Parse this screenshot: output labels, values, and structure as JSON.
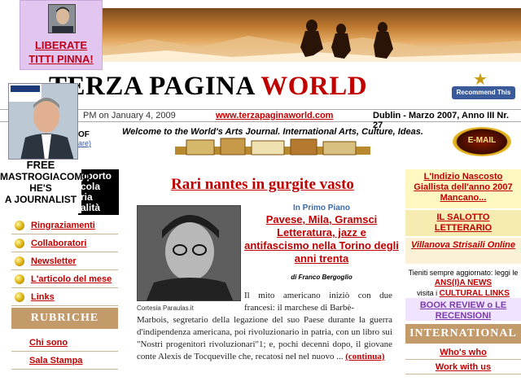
{
  "banner": {
    "description_icon": "hikers-sunset-photo"
  },
  "campaign": {
    "line1": "LIBERATE",
    "line2": "TITTI PINNA!",
    "photo_icon": "portrait-photo"
  },
  "header": {
    "title_black": "TERZA PAGINA",
    "title_red": "WORLD",
    "recommend_label": "Recommend This Site",
    "recommend_icon": "star-icon"
  },
  "info": {
    "date": "PM on January 4, 2009",
    "url": "www.terzapaginaworld.com",
    "edition": "Dublin - Marzo 2007, Anno III Nr. 27"
  },
  "welcome": "Welcome to the World's Arts Journal. International Arts, Culture, Ideas.",
  "email_label": "E-MAIL",
  "overlay": {
    "free_line1": "FREE",
    "free_line2": "MASTROGIACOMO",
    "free_line3": "HE'S",
    "free_line4": "A JOURNALIST",
    "partial_box": "pporto\ncola\nria\nalità",
    "partial_of": "OF",
    "partial_link": "are)"
  },
  "left_nav": {
    "items": [
      {
        "label": "Ringraziamenti"
      },
      {
        "label": "Collaboratori"
      },
      {
        "label": "Newsletter"
      },
      {
        "label": "L'articolo del mese"
      },
      {
        "label": "Links"
      }
    ],
    "rubriche_title": "RUBRICHE",
    "rubriche": [
      {
        "label": "Chi sono"
      },
      {
        "label": "Sala Stampa"
      }
    ]
  },
  "article": {
    "title": "Rari nantes in gurgite vasto",
    "section": "In Primo Piano",
    "subtitle": "Pavese, Mila, Gramsci Letteratura, jazz e antifascismo nella Torino degli anni trenta",
    "byline": "di Franco Bergoglio",
    "caption": "Cortesia Paraulas.it",
    "body_1": "Il mito americano iniziò con due francesi: il marchese di Barbè-",
    "body_2": "Marbois, segretario della legazione del suo Paese durante la guerra d'indipendenza americana, poi rivoluzionario in patria, con un libro sui \"Nostri progenitori rivoluzionari\"1; e, pochi decenni dopo, il giovane conte Alexis de Tocqueville che, recatosi nel nel nuovo ... ",
    "continua": "(continua)"
  },
  "right_col": {
    "box1": "L'Indizio Nascosto Giallista dell'anno 2007 Mancano...",
    "box2": "IL SALOTTO LETTERARIO",
    "box3": "Villanova Strisaili Online",
    "box4_pre": "Tieniti sempre aggiornato: leggi le",
    "box4_link1": "ANS(I)A NEWS",
    "box4_mid": "visita i",
    "box4_link2": "CULTURAL LINKS",
    "box5": "BOOK REVIEW o LE RECENSIONI",
    "international_title": "INTERNATIONAL",
    "links": [
      {
        "label": "Who's who"
      },
      {
        "label": "Work with us"
      }
    ]
  }
}
